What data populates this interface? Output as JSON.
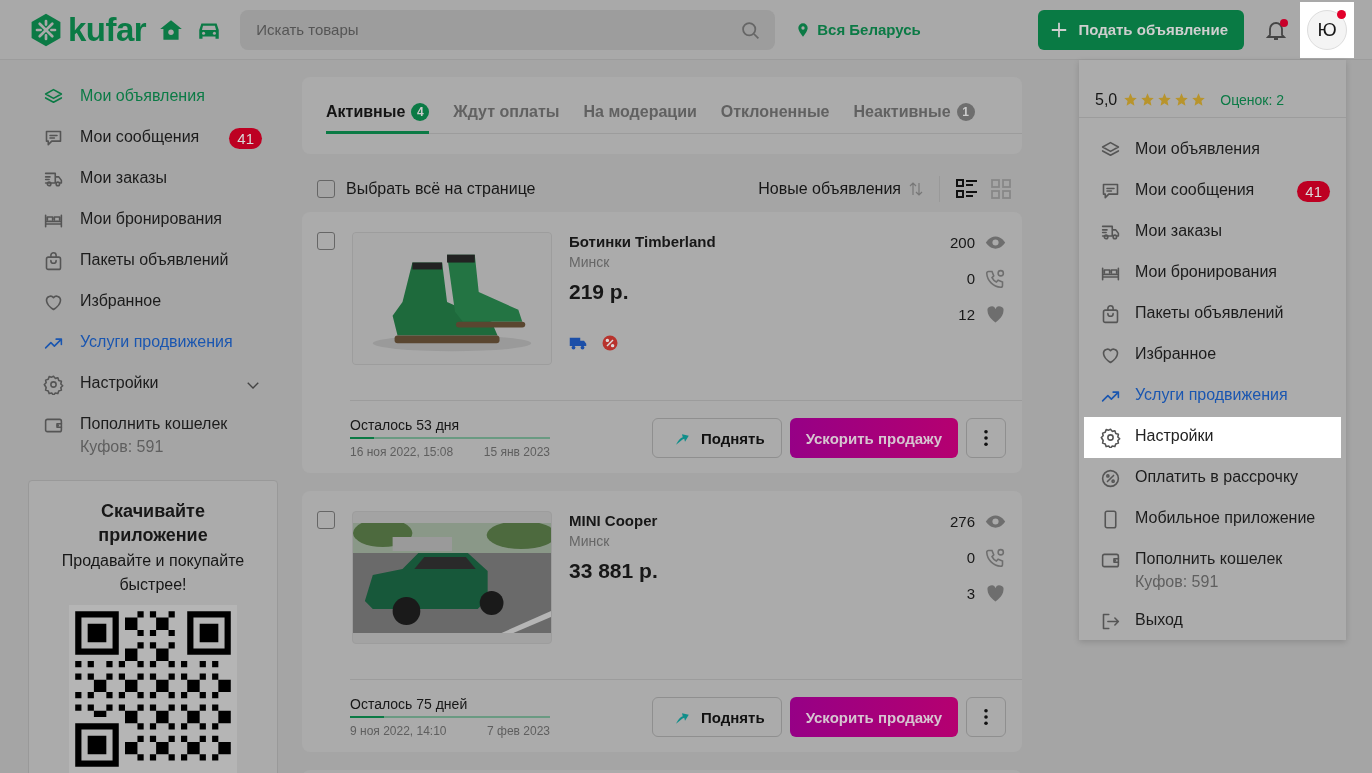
{
  "header": {
    "logo": "kufar",
    "search": {
      "placeholder": "Искать товары"
    },
    "location": "Вся Беларусь",
    "post_button": "Подать объявление",
    "notifications": {
      "unread": true
    },
    "avatar": {
      "letter": "Ю",
      "unread": true
    }
  },
  "sidebar": {
    "items": [
      {
        "label": "Мои объявления",
        "kind": "link",
        "selected": true
      },
      {
        "label": "Мои сообщения",
        "kind": "link",
        "selected": false,
        "badge": "41"
      },
      {
        "label": "Мои заказы",
        "kind": "link",
        "selected": false
      },
      {
        "label": "Мои бронирования",
        "kind": "link",
        "selected": false
      },
      {
        "label": "Пакеты объявлений",
        "kind": "link",
        "selected": false
      },
      {
        "label": "Избранное",
        "kind": "link",
        "selected": false
      },
      {
        "label": "Услуги продвижения",
        "kind": "promo",
        "selected": false
      },
      {
        "label": "Настройки",
        "kind": "link",
        "selected": false,
        "expanded": false
      },
      {
        "label": "Пополнить кошелек",
        "kind": "link",
        "selected": false,
        "note": "Куфов: 591"
      }
    ]
  },
  "app_promo": {
    "title": "Скачивайте приложение",
    "text": "Продавайте и покупайте быстрее!"
  },
  "tabs": [
    {
      "label": "Активные",
      "count": "4",
      "selected": true
    },
    {
      "label": "Ждут оплаты",
      "selected": false
    },
    {
      "label": "На модерации",
      "selected": false
    },
    {
      "label": "Отклоненные",
      "selected": false
    },
    {
      "label": "Неактивные",
      "count": "1",
      "selected": false
    }
  ],
  "toolbar": {
    "select_all": {
      "label": "Выбрать всё на странице",
      "checked": false
    },
    "sort": "Новые объявления",
    "view_modes": [
      {
        "kind": "list",
        "selected": true
      },
      {
        "kind": "grid",
        "selected": false
      }
    ]
  },
  "listings": [
    {
      "title": "Ботинки Timberland",
      "city": "Минск",
      "price": "219 р.",
      "views": "200",
      "calls": "0",
      "likes": "12",
      "delivery": true,
      "discount": true,
      "checked": false,
      "remaining": "Осталось 53 дня",
      "level": 0.12,
      "start": "16 ноя 2022, 15:08",
      "end": "15 янв 2023",
      "raise_button": "Поднять",
      "boost_button": "Ускорить продажу",
      "kind": "boots"
    },
    {
      "title": "MINI Cooper",
      "city": "Минск",
      "price": "33 881 р.",
      "views": "276",
      "calls": "0",
      "likes": "3",
      "checked": false,
      "remaining": "Осталось 75 дней",
      "level": 0.17,
      "start": "9 ноя 2022, 14:10",
      "end": "7 фев 2023",
      "raise_button": "Поднять",
      "boost_button": "Ускорить продажу",
      "kind": "car"
    }
  ],
  "dropdown": {
    "rating": {
      "value": "5,0",
      "stars": 5,
      "count": "Оценок: 2"
    },
    "items": [
      {
        "label": "Мои объявления",
        "kind": "link",
        "selected": false
      },
      {
        "label": "Мои сообщения",
        "kind": "link",
        "selected": false,
        "badge": "41"
      },
      {
        "label": "Мои заказы",
        "kind": "link",
        "selected": false
      },
      {
        "label": "Мои бронирования",
        "kind": "link",
        "selected": false
      },
      {
        "label": "Пакеты объявлений",
        "kind": "link",
        "selected": false
      },
      {
        "label": "Избранное",
        "kind": "link",
        "selected": false
      },
      {
        "label": "Услуги продвижения",
        "kind": "promo",
        "selected": false
      },
      {
        "label": "Настройки",
        "kind": "link",
        "selected": true
      },
      {
        "label": "Оплатить в рассрочку",
        "kind": "link",
        "selected": false
      },
      {
        "label": "Мобильное приложение",
        "kind": "link",
        "selected": false
      },
      {
        "label": "Пополнить кошелек",
        "kind": "link",
        "selected": false,
        "note": "Куфов: 591"
      },
      {
        "label": "Выход",
        "kind": "link",
        "selected": false
      }
    ]
  }
}
